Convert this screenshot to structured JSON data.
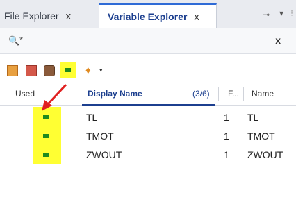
{
  "tabs": [
    {
      "label": "File Explorer",
      "close": "x"
    },
    {
      "label": "Variable Explorer",
      "close": "x"
    }
  ],
  "tab_controls": {
    "pin": "⊸",
    "menu": "▾",
    "edge": "⁝"
  },
  "search": {
    "icon": "search-icon",
    "value": "*",
    "clear_label": "x"
  },
  "toolbar": {
    "icons": [
      "table-orange-icon",
      "table-red-icon",
      "variable-icon",
      "used-indicator-icon",
      "tag-icon"
    ],
    "dropdown": "▾"
  },
  "columns": {
    "used": "Used",
    "display_name": "Display Name",
    "count": "(3/6)",
    "f": "F...",
    "name": "Name"
  },
  "rows": [
    {
      "display_name": "TL",
      "f": "1",
      "name": "TL"
    },
    {
      "display_name": "TMOT",
      "f": "1",
      "name": "TMOT"
    },
    {
      "display_name": "ZWOUT",
      "f": "1",
      "name": "ZWOUT"
    }
  ],
  "colors": {
    "highlight": "#ffff33",
    "used_marker": "#1e8a1e",
    "accent": "#1c3f8f",
    "arrow": "#e02020"
  }
}
